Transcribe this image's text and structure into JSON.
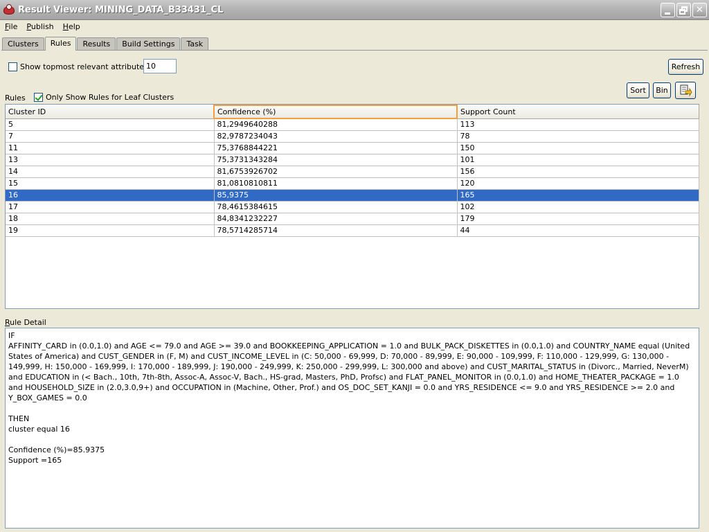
{
  "window": {
    "title": "Result Viewer: MINING_DATA_B33431_CL"
  },
  "menu": [
    {
      "label": "File",
      "mnemonic": "F",
      "rest": "ile"
    },
    {
      "label": "Publish",
      "mnemonic": "P",
      "rest": "ublish"
    },
    {
      "label": "Help",
      "mnemonic": "H",
      "rest": "elp"
    }
  ],
  "tabs": [
    {
      "label": "Clusters",
      "active": false
    },
    {
      "label": "Rules",
      "active": true
    },
    {
      "label": "Results",
      "active": false
    },
    {
      "label": "Build Settings",
      "active": false
    },
    {
      "label": "Task",
      "active": false
    }
  ],
  "topmost": {
    "label": "Show topmost relevant attributes:",
    "checked": false,
    "value": "10"
  },
  "buttons": {
    "refresh": "Refresh",
    "sort": "Sort",
    "bin": "Bin"
  },
  "rules_section": {
    "label": "Rules",
    "leaf_label": "Only Show Rules for Leaf Clusters",
    "leaf_checked": true
  },
  "table": {
    "columns": [
      "Cluster ID",
      "Confidence (%)",
      "Support Count"
    ],
    "rows": [
      [
        "5",
        "81,2949640288",
        "113"
      ],
      [
        "7",
        "82,9787234043",
        "78"
      ],
      [
        "11",
        "75,3768844221",
        "150"
      ],
      [
        "13",
        "75,3731343284",
        "101"
      ],
      [
        "14",
        "81,6753926702",
        "156"
      ],
      [
        "15",
        "81,0810810811",
        "120"
      ],
      [
        "16",
        "85,9375",
        "165"
      ],
      [
        "17",
        "78,4615384615",
        "102"
      ],
      [
        "18",
        "84,8341232227",
        "179"
      ],
      [
        "19",
        "78,5714285714",
        "44"
      ]
    ],
    "selected_row": 6
  },
  "rule_detail": {
    "label": "Rule Detail",
    "lines": [
      "IF",
      "AFFINITY_CARD in (0.0,1.0) and AGE <= 79.0 and AGE >= 39.0 and BOOKKEEPING_APPLICATION = 1.0 and BULK_PACK_DISKETTES in (0.0,1.0) and COUNTRY_NAME equal (United States of America) and CUST_GENDER in (F, M) and CUST_INCOME_LEVEL in (C: 50,000 - 69,999, D: 70,000 - 89,999, E: 90,000 - 109,999, F: 110,000 - 129,999, G: 130,000 - 149,999, H: 150,000 - 169,999, I: 170,000 - 189,999, J: 190,000 - 249,999, K: 250,000 - 299,999, L: 300,000 and above) and CUST_MARITAL_STATUS in (Divorc., Married, NeverM) and EDUCATION in (< Bach., 10th, 7th-8th, Assoc-A, Assoc-V, Bach., HS-grad, Masters, PhD, Profsc) and FLAT_PANEL_MONITOR in (0.0,1.0) and HOME_THEATER_PACKAGE = 1.0 and HOUSEHOLD_SIZE in (2.0,3.0,9+) and OCCUPATION in (Machine, Other, Prof.) and OS_DOC_SET_KANJI = 0.0 and YRS_RESIDENCE <= 9.0 and YRS_RESIDENCE >= 2.0 and Y_BOX_GAMES = 0.0",
      "",
      "THEN",
      "cluster equal 16",
      "",
      "Confidence (%)=85.9375",
      "Support =165"
    ]
  }
}
